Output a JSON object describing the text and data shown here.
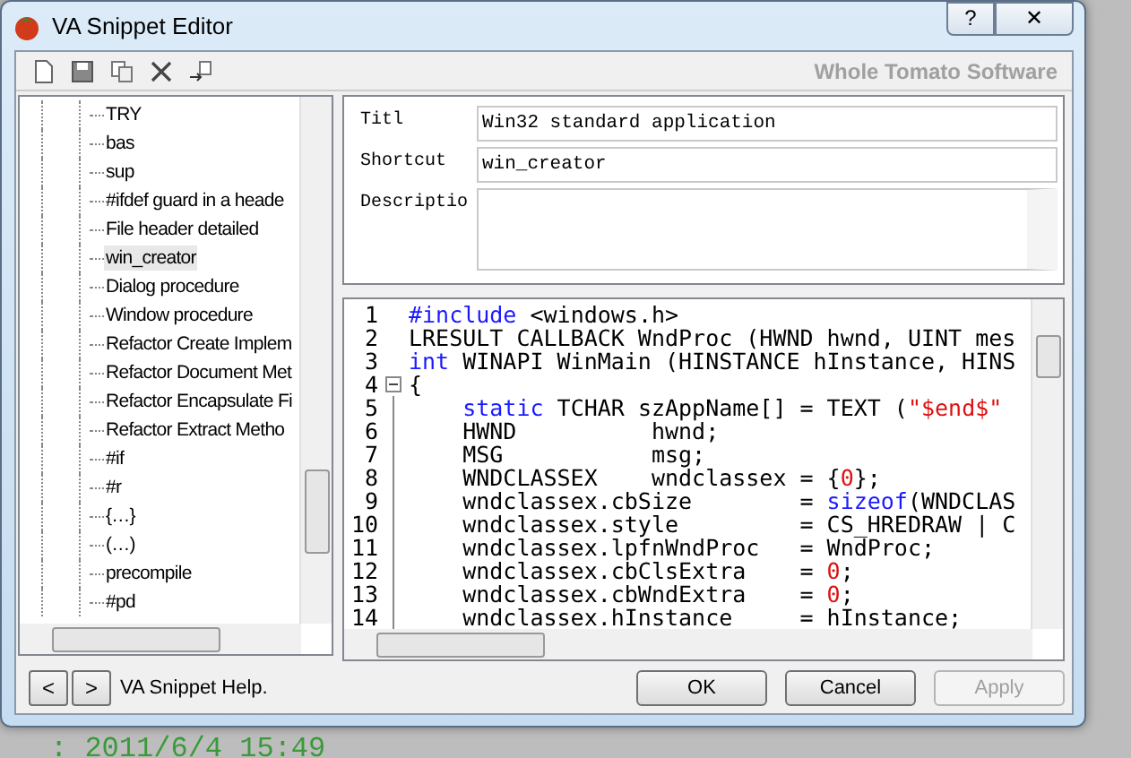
{
  "window": {
    "title": "VA Snippet Editor",
    "help_button": "?",
    "close_button": "✕"
  },
  "toolbar": {
    "brand": "Whole Tomato Software"
  },
  "tree": {
    "items": [
      {
        "label": "TRY",
        "selected": false
      },
      {
        "label": "bas",
        "selected": false
      },
      {
        "label": "sup",
        "selected": false
      },
      {
        "label": "#ifdef guard in a heade",
        "selected": false
      },
      {
        "label": "File header detailed",
        "selected": false
      },
      {
        "label": "win_creator",
        "selected": true
      },
      {
        "label": "Dialog procedure",
        "selected": false
      },
      {
        "label": "Window procedure",
        "selected": false
      },
      {
        "label": "Refactor Create Implem",
        "selected": false
      },
      {
        "label": "Refactor Document Met",
        "selected": false
      },
      {
        "label": "Refactor Encapsulate Fi",
        "selected": false
      },
      {
        "label": "Refactor Extract Metho",
        "selected": false
      },
      {
        "label": "#if",
        "selected": false
      },
      {
        "label": "#r",
        "selected": false
      },
      {
        "label": "{…}",
        "selected": false
      },
      {
        "label": "(…)",
        "selected": false
      },
      {
        "label": "precompile",
        "selected": false
      },
      {
        "label": "#pd",
        "selected": false
      }
    ]
  },
  "form": {
    "title_label": "Titl",
    "title_value": "Win32 standard application",
    "shortcut_label": "Shortcut",
    "shortcut_value": "win_creator",
    "description_label": "Descriptio"
  },
  "code": {
    "lines": [
      {
        "number": "1",
        "fold": false,
        "tokens": [
          {
            "kind": "keyword",
            "text": "#include"
          },
          {
            "kind": "plain",
            "text": " <windows.h>"
          }
        ]
      },
      {
        "number": "2",
        "fold": false,
        "tokens": [
          {
            "kind": "plain",
            "text": "LRESULT CALLBACK WndProc (HWND hwnd, UINT mes"
          }
        ]
      },
      {
        "number": "3",
        "fold": false,
        "tokens": [
          {
            "kind": "keyword",
            "text": "int"
          },
          {
            "kind": "plain",
            "text": " WINAPI WinMain (HINSTANCE hInstance, HINS"
          }
        ]
      },
      {
        "number": "4",
        "fold": true,
        "tokens": [
          {
            "kind": "plain",
            "text": "{"
          }
        ]
      },
      {
        "number": "5",
        "fold": false,
        "tokens": [
          {
            "kind": "keyword",
            "text": "    static"
          },
          {
            "kind": "plain",
            "text": " TCHAR szAppName[] = TEXT ("
          },
          {
            "kind": "string",
            "text": "\"$end$\""
          }
        ]
      },
      {
        "number": "6",
        "fold": false,
        "tokens": [
          {
            "kind": "plain",
            "text": "    HWND          hwnd;"
          }
        ]
      },
      {
        "number": "7",
        "fold": false,
        "tokens": [
          {
            "kind": "plain",
            "text": "    MSG           msg;"
          }
        ]
      },
      {
        "number": "8",
        "fold": false,
        "tokens": [
          {
            "kind": "plain",
            "text": "    WNDCLASSEX    wndclassex = {"
          },
          {
            "kind": "number",
            "text": "0"
          },
          {
            "kind": "plain",
            "text": "};"
          }
        ]
      },
      {
        "number": "9",
        "fold": false,
        "tokens": [
          {
            "kind": "plain",
            "text": "    wndclassex.cbSize        = "
          },
          {
            "kind": "keyword",
            "text": "sizeof"
          },
          {
            "kind": "plain",
            "text": "(WNDCLAS"
          }
        ]
      },
      {
        "number": "10",
        "fold": false,
        "tokens": [
          {
            "kind": "plain",
            "text": "    wndclassex.style         = CS_HREDRAW | C"
          }
        ]
      },
      {
        "number": "11",
        "fold": false,
        "tokens": [
          {
            "kind": "plain",
            "text": "    wndclassex.lpfnWndProc   = WndProc;"
          }
        ]
      },
      {
        "number": "12",
        "fold": false,
        "tokens": [
          {
            "kind": "plain",
            "text": "    wndclassex.cbClsExtra    = "
          },
          {
            "kind": "number",
            "text": "0"
          },
          {
            "kind": "plain",
            "text": ";"
          }
        ]
      },
      {
        "number": "13",
        "fold": false,
        "tokens": [
          {
            "kind": "plain",
            "text": "    wndclassex.cbWndExtra    = "
          },
          {
            "kind": "number",
            "text": "0"
          },
          {
            "kind": "plain",
            "text": ";"
          }
        ]
      },
      {
        "number": "14",
        "fold": false,
        "tokens": [
          {
            "kind": "plain",
            "text": "    wndclassex.hInstance     = hInstance;"
          }
        ]
      }
    ]
  },
  "footer": {
    "prev_button": "<",
    "next_button": ">",
    "help_link": "VA Snippet Help.",
    "buttons": [
      {
        "label": "OK",
        "disabled": false
      },
      {
        "label": "Cancel",
        "disabled": false
      },
      {
        "label": "Apply",
        "disabled": true
      }
    ]
  },
  "background_text": ": 2011/6/4 15:49"
}
